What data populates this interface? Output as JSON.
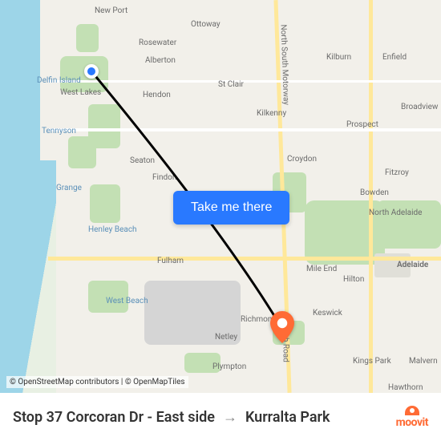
{
  "cta_label": "Take me there",
  "attribution": "© OpenStreetMap contributors | © OpenMapTiles",
  "route": {
    "from": "Stop 37 Corcoran Dr - East side",
    "to": "Kurralta Park"
  },
  "brand": "moovit",
  "labels": {
    "newport": "New Port",
    "ottoway": "Ottoway",
    "rosewater": "Rosewater",
    "alberton": "Alberton",
    "kilburn": "Kilburn",
    "enfield": "Enfield",
    "delfin": "Delfin Island",
    "westlakes": "West Lakes",
    "hendon": "Hendon",
    "stclair": "St Clair",
    "kilkenny": "Kilkenny",
    "prospect": "Prospect",
    "broadview": "Broadview",
    "tennyson": "Tennyson",
    "seaton": "Seaton",
    "findon": "Findon",
    "croydon": "Croydon",
    "fitzroy": "Fitzroy",
    "bowden": "Bowden",
    "grange": "Grange",
    "northadelaide": "North Adelaide",
    "henley": "Henley Beach",
    "adelaide": "Adelaide",
    "fulham": "Fulham",
    "mileend": "Mile End",
    "hilton": "Hilton",
    "westbeach": "West Beach",
    "richmond": "Richmond",
    "keswick": "Keswick",
    "netley": "Netley",
    "southroad": "South Road",
    "plympton": "Plympton",
    "kingspark": "Kings Park",
    "malvern": "Malvern",
    "hawthorn": "Hawthorn",
    "motorway": "North South Motorway"
  }
}
